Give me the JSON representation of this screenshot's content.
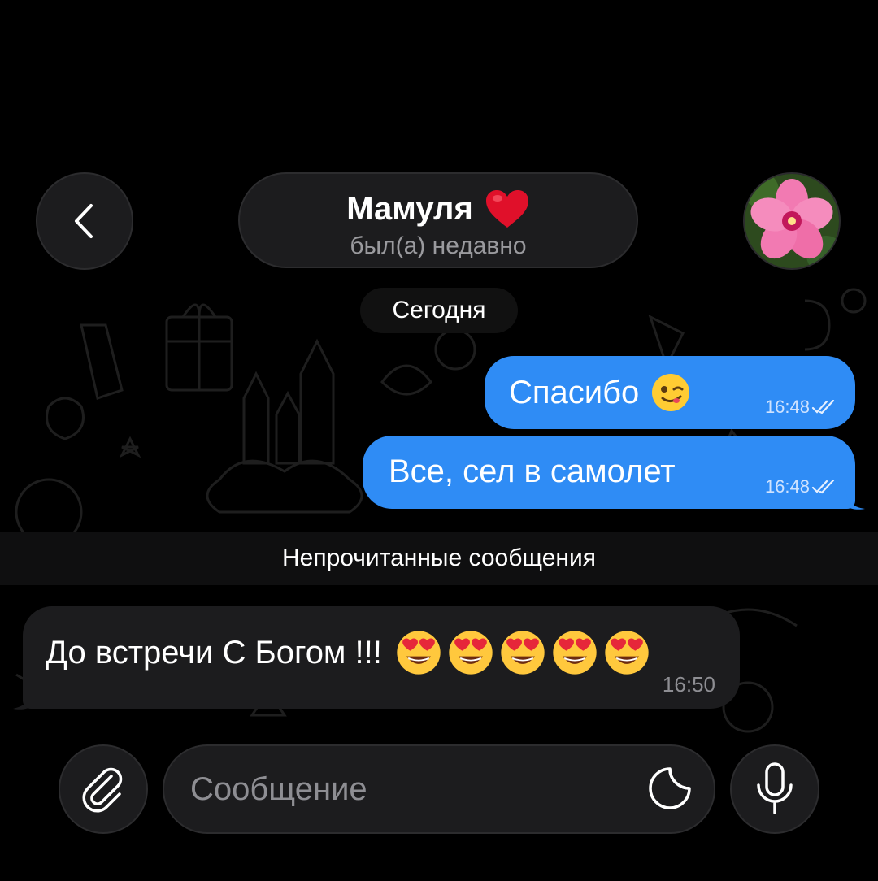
{
  "header": {
    "contact_name": "Мамуля",
    "contact_status": "был(а) недавно",
    "heart_emoji": "heart-icon",
    "back_icon": "chevron-left-icon",
    "avatar": "flower-avatar"
  },
  "chat": {
    "date_label": "Сегодня",
    "unread_label": "Непрочитанные сообщения",
    "messages": [
      {
        "direction": "out",
        "text": "Спасибо",
        "emoji": "wink-emoji",
        "time": "16:48",
        "read": true
      },
      {
        "direction": "out",
        "text": "Все, сел в самолет",
        "time": "16:48",
        "read": true
      },
      {
        "direction": "in",
        "text": "До встречи С Богом !!!",
        "emoji_count": 5,
        "emoji": "heart-eyes-emoji",
        "time": "16:50"
      }
    ]
  },
  "composer": {
    "placeholder": "Сообщение",
    "attach_icon": "paperclip-icon",
    "sticker_icon": "sticker-icon",
    "mic_icon": "microphone-icon"
  },
  "colors": {
    "outgoing_bubble": "#2f8cf5",
    "incoming_bubble": "#1c1c1e",
    "background": "#000000"
  }
}
